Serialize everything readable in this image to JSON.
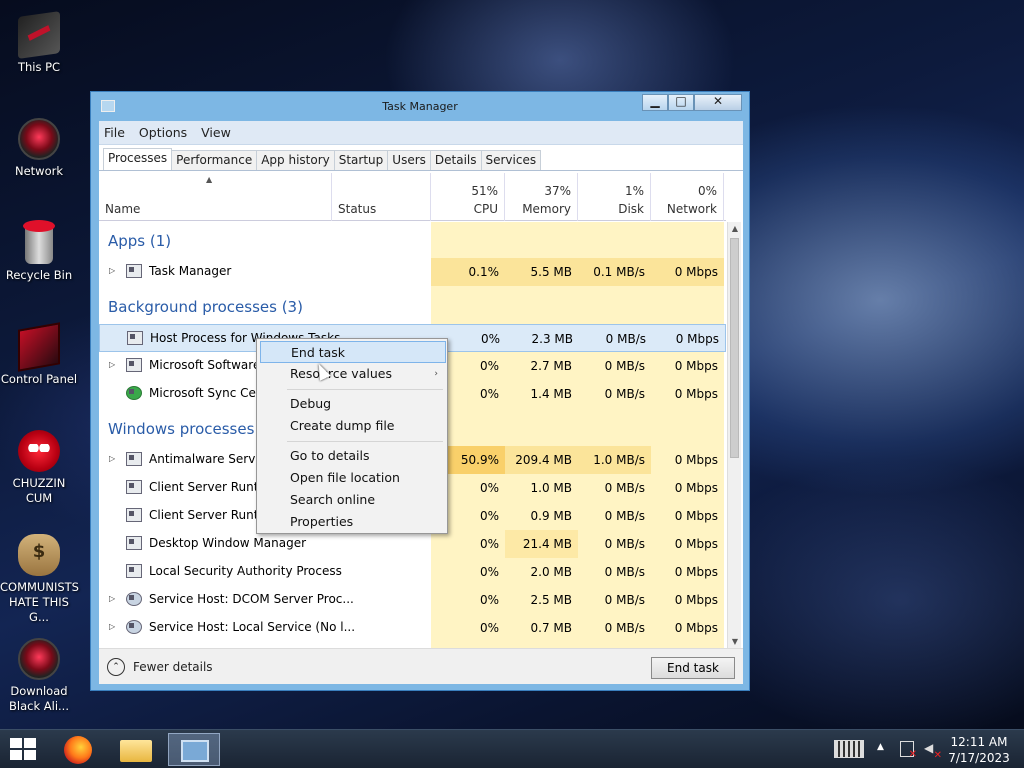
{
  "desktop": {
    "icons": [
      {
        "label": "This PC"
      },
      {
        "label": "Network"
      },
      {
        "label": "Recycle Bin"
      },
      {
        "label": "Control Panel"
      },
      {
        "label": "CHUZZIN CUM"
      },
      {
        "label": "COMMUNISTS HATE THIS G..."
      },
      {
        "label": "Download Black Ali..."
      }
    ]
  },
  "window": {
    "title": "Task Manager",
    "menu": [
      "File",
      "Options",
      "View"
    ],
    "tabs": [
      "Processes",
      "Performance",
      "App history",
      "Startup",
      "Users",
      "Details",
      "Services"
    ],
    "active_tab": "Processes",
    "columns": {
      "name": "Name",
      "status": "Status",
      "cpu_pct": "51%",
      "cpu": "CPU",
      "mem_pct": "37%",
      "mem": "Memory",
      "disk_pct": "1%",
      "disk": "Disk",
      "net_pct": "0%",
      "net": "Network"
    },
    "groups": [
      {
        "title": "Apps (1)"
      },
      {
        "title": "Background processes (3)"
      },
      {
        "title": "Windows processes ("
      }
    ],
    "rows": [
      {
        "name": "Task Manager",
        "cpu": "0.1%",
        "mem": "5.5 MB",
        "disk": "0.1 MB/s",
        "net": "0 Mbps"
      },
      {
        "name": "Host Process for Windows Tasks",
        "cpu": "0%",
        "mem": "2.3 MB",
        "disk": "0 MB/s",
        "net": "0 Mbps"
      },
      {
        "name": "Microsoft Software P",
        "cpu": "0%",
        "mem": "2.7 MB",
        "disk": "0 MB/s",
        "net": "0 Mbps"
      },
      {
        "name": "Microsoft Sync Cent",
        "cpu": "0%",
        "mem": "1.4 MB",
        "disk": "0 MB/s",
        "net": "0 Mbps"
      },
      {
        "name": "Antimalware Service",
        "cpu": "50.9%",
        "mem": "209.4 MB",
        "disk": "1.0 MB/s",
        "net": "0 Mbps"
      },
      {
        "name": "Client Server Runtim",
        "cpu": "0%",
        "mem": "1.0 MB",
        "disk": "0 MB/s",
        "net": "0 Mbps"
      },
      {
        "name": "Client Server Runtim",
        "cpu": "0%",
        "mem": "0.9 MB",
        "disk": "0 MB/s",
        "net": "0 Mbps"
      },
      {
        "name": "Desktop Window Manager",
        "cpu": "0%",
        "mem": "21.4 MB",
        "disk": "0 MB/s",
        "net": "0 Mbps"
      },
      {
        "name": "Local Security Authority Process",
        "cpu": "0%",
        "mem": "2.0 MB",
        "disk": "0 MB/s",
        "net": "0 Mbps"
      },
      {
        "name": "Service Host: DCOM Server Proc...",
        "cpu": "0%",
        "mem": "2.5 MB",
        "disk": "0 MB/s",
        "net": "0 Mbps"
      },
      {
        "name": "Service Host: Local Service (No l...",
        "cpu": "0%",
        "mem": "0.7 MB",
        "disk": "0 MB/s",
        "net": "0 Mbps"
      }
    ],
    "footer": {
      "fewer_details": "Fewer details",
      "end_task": "End task"
    }
  },
  "context_menu": {
    "items": [
      "End task",
      "Resource values",
      "Debug",
      "Create dump file",
      "Go to details",
      "Open file location",
      "Search online",
      "Properties"
    ],
    "highlighted": "End task"
  },
  "taskbar": {
    "clock_time": "12:11 AM",
    "clock_date": "7/17/2023"
  },
  "colors": {
    "window_frame": "#7db7e4",
    "group_title": "#2a5ca8",
    "cpu_heat_high": "#f9d06a",
    "heat_low": "#fff4c4"
  }
}
